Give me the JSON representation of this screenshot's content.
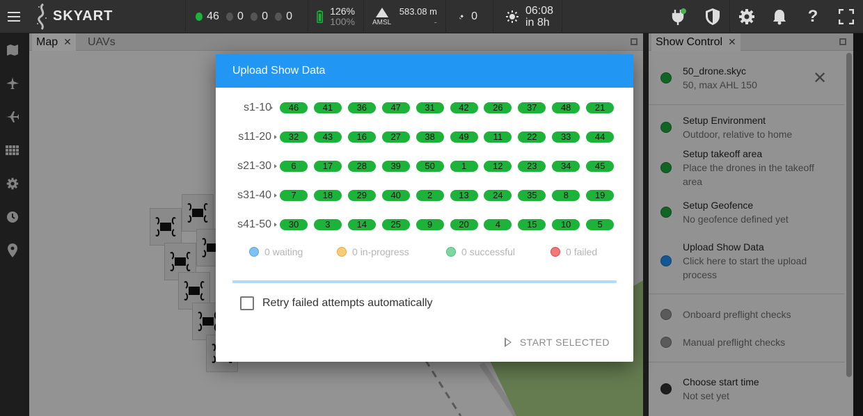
{
  "app": {
    "logo_text": "SKYART"
  },
  "topbar": {
    "uav_counts": [
      {
        "value": "46",
        "color": "#1db33a"
      },
      {
        "value": "0",
        "color": "#555555"
      },
      {
        "value": "0",
        "color": "#555555"
      },
      {
        "value": "0",
        "color": "#555555"
      }
    ],
    "battery": {
      "primary": "126%",
      "secondary": "100%"
    },
    "altitude": {
      "value": "583.08 m",
      "reference": "AMSL",
      "secondary": "-"
    },
    "rtk_count": "0",
    "clock": {
      "time": "06:08",
      "relative": "in 8h"
    }
  },
  "sidebar": {
    "items": [
      "map-icon",
      "plane-icon",
      "fixed-wing-icon",
      "grid-icon",
      "settings-icon",
      "clock-icon",
      "location-icon"
    ]
  },
  "map_panel": {
    "tabs": [
      {
        "label": "Map",
        "closable": true,
        "active": true
      },
      {
        "label": "UAVs",
        "closable": false,
        "active": false
      }
    ]
  },
  "show_control": {
    "tab_label": "Show Control",
    "items": [
      {
        "title": "50_drone.skyc",
        "subtitle": "50, max AHL 150",
        "status_color": "#1d9a3a"
      },
      {
        "title": "Setup Environment",
        "subtitle": "Outdoor, relative to home",
        "status_color": "#1d9a3a"
      },
      {
        "title": "Setup takeoff area",
        "subtitle": "Place the drones in the takeoff area",
        "status_color": "#1d9a3a"
      },
      {
        "title": "Setup Geofence",
        "subtitle": "No geofence defined yet",
        "status_color": "#1d9a3a"
      },
      {
        "title": "Upload Show Data",
        "subtitle": "Click here to start the upload process",
        "status_color": "#1e88e5"
      },
      {
        "title": "Onboard preflight checks",
        "subtitle": "",
        "status_color": "#8a8a8a"
      },
      {
        "title": "Manual preflight checks",
        "subtitle": "",
        "status_color": "#8a8a8a"
      },
      {
        "title": "Choose start time",
        "subtitle": "Not set yet",
        "status_color": "#2e2e2e"
      }
    ]
  },
  "dialog": {
    "title": "Upload Show Data",
    "rows": [
      {
        "label": "s1-10",
        "values": [
          "46",
          "41",
          "36",
          "47",
          "31",
          "42",
          "26",
          "37",
          "48",
          "21"
        ]
      },
      {
        "label": "s11-20",
        "values": [
          "32",
          "43",
          "16",
          "27",
          "38",
          "49",
          "11",
          "22",
          "33",
          "44"
        ]
      },
      {
        "label": "s21-30",
        "values": [
          "6",
          "17",
          "28",
          "39",
          "50",
          "1",
          "12",
          "23",
          "34",
          "45"
        ]
      },
      {
        "label": "s31-40",
        "values": [
          "7",
          "18",
          "29",
          "40",
          "2",
          "13",
          "24",
          "35",
          "8",
          "19"
        ]
      },
      {
        "label": "s41-50",
        "values": [
          "30",
          "3",
          "14",
          "25",
          "9",
          "20",
          "4",
          "15",
          "10",
          "5"
        ]
      }
    ],
    "legend": [
      {
        "count": "0",
        "label": "waiting",
        "color": "#7fc2f2"
      },
      {
        "count": "0",
        "label": "in-progress",
        "color": "#f7cb78"
      },
      {
        "count": "0",
        "label": "successful",
        "color": "#7fd6a0"
      },
      {
        "count": "0",
        "label": "failed",
        "color": "#f07a7a"
      }
    ],
    "retry_label": "Retry failed attempts automatically",
    "retry_checked": false,
    "start_button_label": "START SELECTED"
  }
}
